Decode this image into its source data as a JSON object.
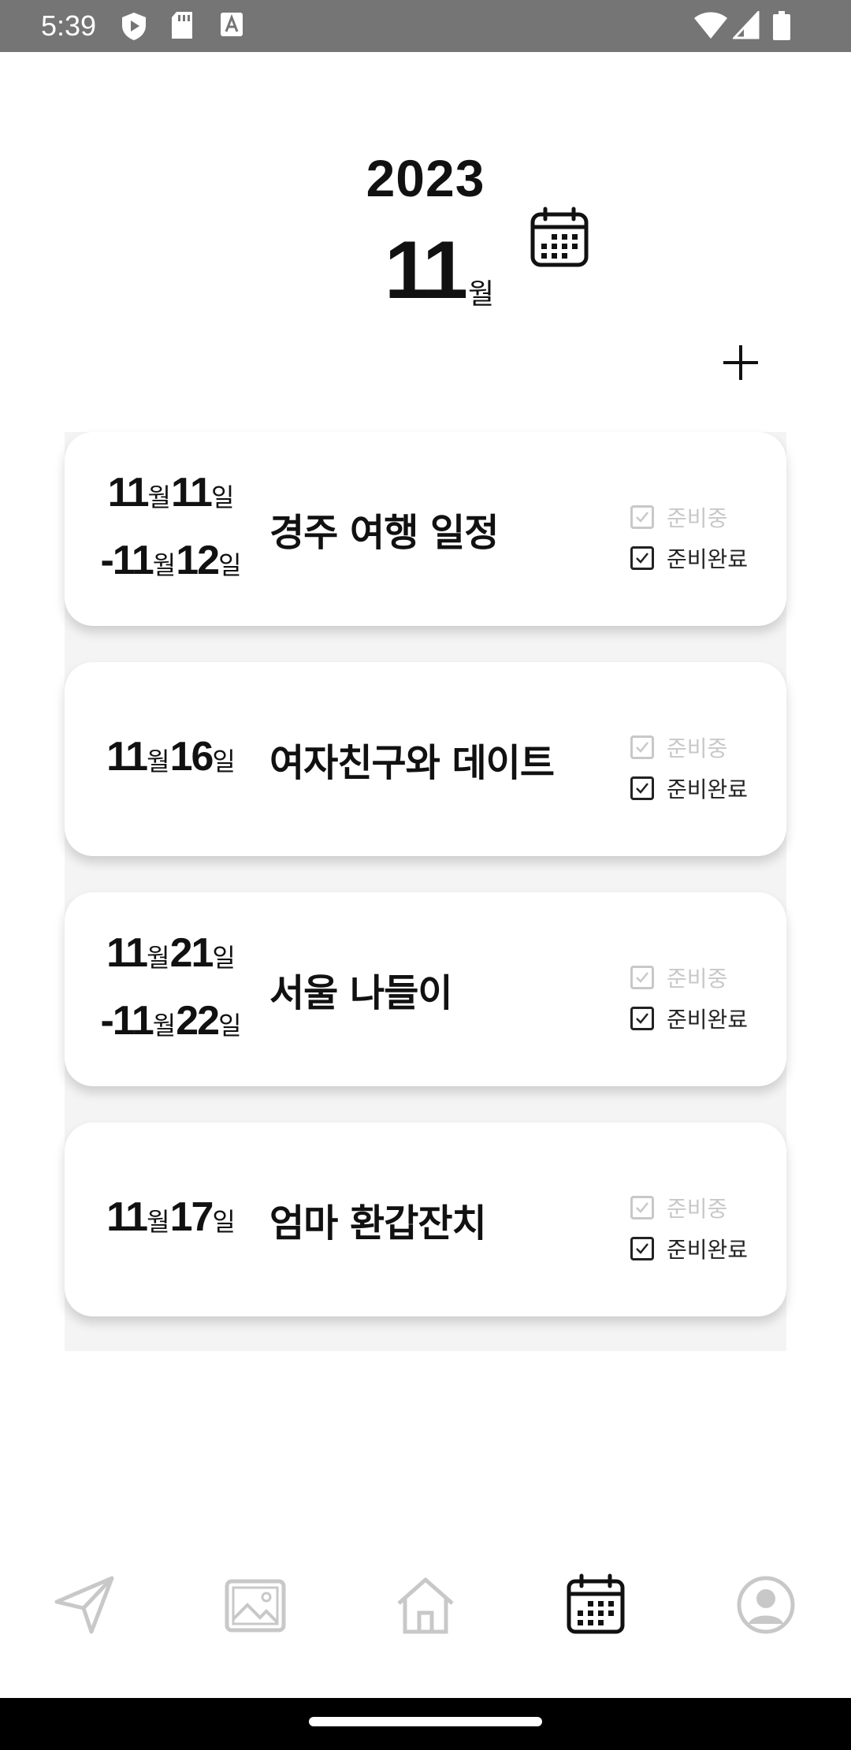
{
  "status_bar": {
    "time": "5:39",
    "left_icons": [
      "play-protect-icon",
      "sd-card-icon",
      "font-a-icon"
    ],
    "right_icons": [
      "wifi-icon",
      "cell-signal-icon",
      "battery-icon"
    ]
  },
  "header": {
    "year": "2023",
    "month": "11",
    "month_unit": "월",
    "calendar_icon": "calendar-icon",
    "add_icon": "plus-icon"
  },
  "schedules": [
    {
      "start": {
        "month": "11",
        "month_unit": "월",
        "day": "11",
        "day_unit": "일"
      },
      "end": {
        "prefix": "-",
        "month": "11",
        "month_unit": "월",
        "day": "12",
        "day_unit": "일"
      },
      "title": "경주 여행 일정",
      "status_preparing": "준비중",
      "status_done": "준비완료"
    },
    {
      "start": {
        "month": "11",
        "month_unit": "월",
        "day": "16",
        "day_unit": "일"
      },
      "title": "여자친구와 데이트",
      "status_preparing": "준비중",
      "status_done": "준비완료"
    },
    {
      "start": {
        "month": "11",
        "month_unit": "월",
        "day": "21",
        "day_unit": "일"
      },
      "end": {
        "prefix": "-",
        "month": "11",
        "month_unit": "월",
        "day": "22",
        "day_unit": "일"
      },
      "title": "서울 나들이",
      "status_preparing": "준비중",
      "status_done": "준비완료"
    },
    {
      "start": {
        "month": "11",
        "month_unit": "월",
        "day": "17",
        "day_unit": "일"
      },
      "title": "엄마 환갑잔치",
      "status_preparing": "준비중",
      "status_done": "준비완료"
    }
  ],
  "bottom_nav": {
    "items": [
      "send-icon",
      "gallery-icon",
      "home-icon",
      "calendar-icon",
      "profile-icon"
    ],
    "active": "calendar-icon"
  },
  "colors": {
    "status_bar": "#757575",
    "inactive_icon": "#c8c8c8",
    "active_icon": "#111111",
    "list_background": "#f4f4f4"
  }
}
